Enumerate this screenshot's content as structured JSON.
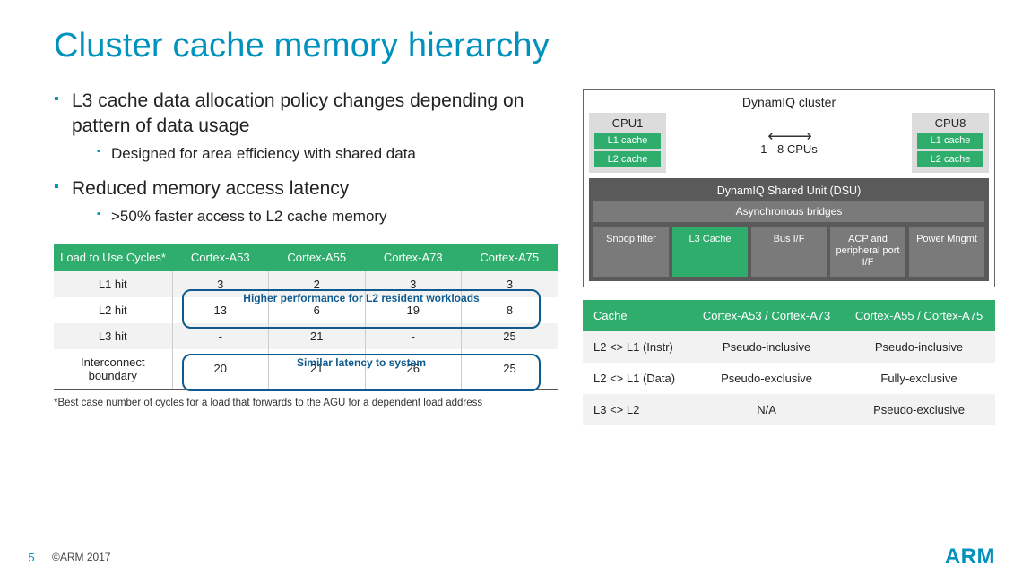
{
  "title": "Cluster cache memory hierarchy",
  "bullets": [
    {
      "text": "L3 cache data allocation policy changes depending on pattern of data usage",
      "sub": [
        "Designed for area efficiency with shared data"
      ]
    },
    {
      "text": "Reduced memory access latency",
      "sub": [
        ">50% faster access to L2 cache memory"
      ]
    }
  ],
  "diagram": {
    "cluster_title": "DynamIQ cluster",
    "cpu1": {
      "label": "CPU1",
      "l1": "L1 cache",
      "l2": "L2 cache"
    },
    "cpu_range": "1 - 8 CPUs",
    "cpu8": {
      "label": "CPU8",
      "l1": "L1 cache",
      "l2": "L2 cache"
    },
    "dsu_title": "DynamIQ Shared Unit (DSU)",
    "async": "Asynchronous bridges",
    "blocks": [
      "Snoop filter",
      "L3 Cache",
      "Bus I/F",
      "ACP and peripheral port I/F",
      "Power Mngmt"
    ]
  },
  "left_table": {
    "headers": [
      "Load to Use Cycles*",
      "Cortex-A53",
      "Cortex-A55",
      "Cortex-A73",
      "Cortex-A75"
    ],
    "rows": [
      [
        "L1 hit",
        "3",
        "2",
        "3",
        "3"
      ],
      [
        "L2 hit",
        "13",
        "6",
        "19",
        "8"
      ],
      [
        "L3 hit",
        "-",
        "21",
        "-",
        "25"
      ],
      [
        "Interconnect boundary",
        "20",
        "21",
        "26",
        "25"
      ]
    ],
    "callout1": "Higher performance for L2 resident workloads",
    "callout2": "Similar latency to system",
    "footnote": "*Best case number of cycles for a load that forwards to the AGU for a dependent load address"
  },
  "right_table": {
    "headers": [
      "Cache",
      "Cortex-A53 / Cortex-A73",
      "Cortex-A55 / Cortex-A75"
    ],
    "rows": [
      [
        "L2 <> L1 (Instr)",
        "Pseudo-inclusive",
        "Pseudo-inclusive"
      ],
      [
        "L2 <> L1 (Data)",
        "Pseudo-exclusive",
        "Fully-exclusive"
      ],
      [
        "L3 <> L2",
        "N/A",
        "Pseudo-exclusive"
      ]
    ]
  },
  "footer": {
    "page": "5",
    "copyright": "©ARM 2017",
    "logo": "ARM"
  }
}
